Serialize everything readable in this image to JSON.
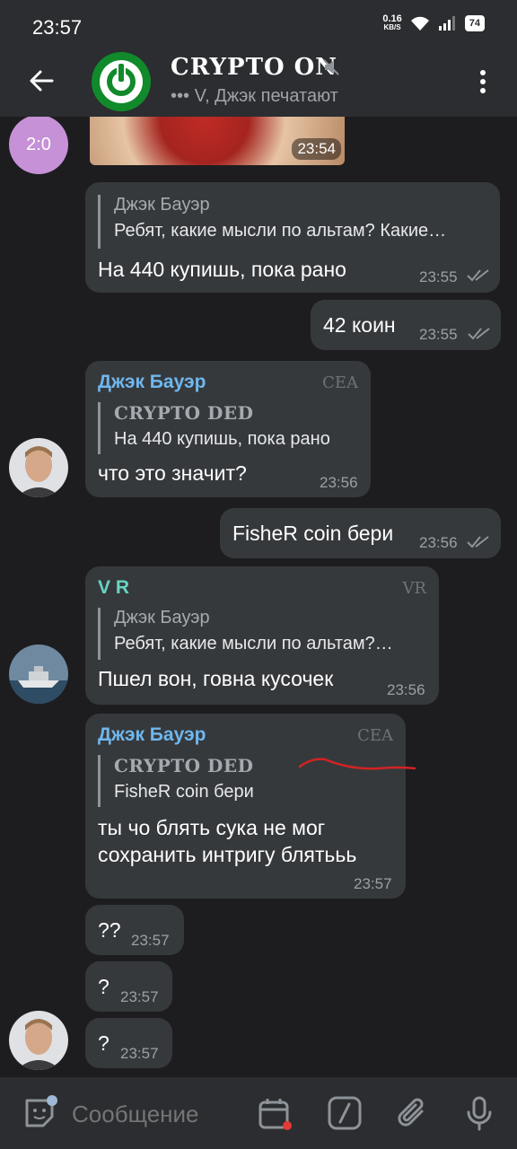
{
  "status": {
    "time": "23:57",
    "net_speed": "0.16",
    "net_unit": "KB/S",
    "battery": "74"
  },
  "header": {
    "title": "CRYPTO ON",
    "subtitle": "••• V, Джэк печатают"
  },
  "messages": [
    {
      "id": "img",
      "time": "23:54",
      "avatar_text": "2:0"
    },
    {
      "id": "m1",
      "reply_name": "Джэк Бауэр",
      "reply_text": "Ребят, какие мысли по альтам? Какие…",
      "text": "На 440 купишь, пока рано",
      "time": "23:55"
    },
    {
      "id": "m2",
      "text": "42 коин",
      "time": "23:55"
    },
    {
      "id": "m3",
      "sender": "Джэк Бауэр",
      "tag": "CEA",
      "reply_name": "CRYPTO DED",
      "reply_text": "На 440 купишь, пока рано",
      "text": "что это значит?",
      "time": "23:56"
    },
    {
      "id": "m4",
      "text": "FisheR coin бери",
      "time": "23:56"
    },
    {
      "id": "m5",
      "sender": "V R",
      "tag": "VR",
      "reply_name": "Джэк Бауэр",
      "reply_text": "Ребят, какие мысли по альтам?…",
      "text": "Пшел вон, говна кусочек",
      "time": "23:56"
    },
    {
      "id": "m6",
      "sender": "Джэк Бауэр",
      "tag": "CEA",
      "reply_name": "CRYPTO DED",
      "reply_text": "FisheR coin бери",
      "text": "ты чо блять сука не мог\nсохранить интригу блятььь",
      "time": "23:57"
    },
    {
      "id": "m7",
      "text": "??",
      "time": "23:57"
    },
    {
      "id": "m8",
      "text": "?",
      "time": "23:57"
    },
    {
      "id": "m9",
      "text": "?",
      "time": "23:57"
    }
  ],
  "composer": {
    "placeholder": "Сообщение"
  },
  "colors": {
    "accent": "#6fb7ee",
    "sender_green": "#67d5c4",
    "incoming_bubble": "#36393c",
    "outgoing_bubble": "#4f5256",
    "brand": "#118a2b",
    "annotation_red": "#d22323"
  }
}
